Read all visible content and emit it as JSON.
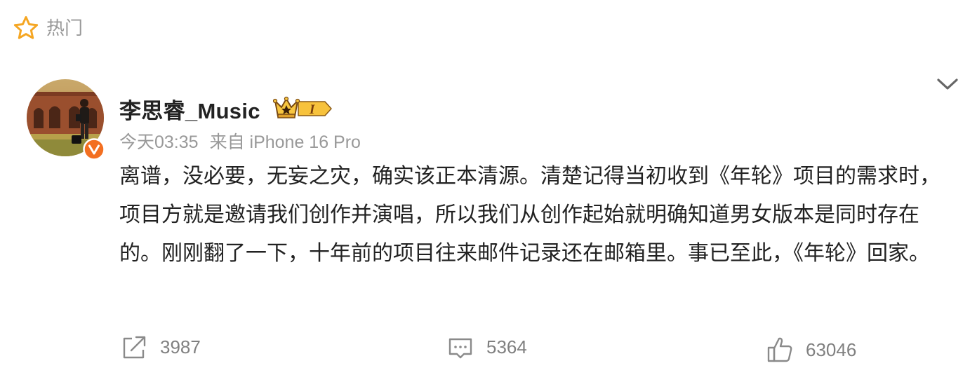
{
  "header": {
    "hot_label": "热门",
    "hot_icon": "star-outline-icon"
  },
  "post": {
    "author": {
      "name": "李思睿_Music",
      "avatar": "avatar-photo",
      "verified_badge": "verified-v-icon",
      "vip_badge_text": "I"
    },
    "meta": {
      "time": "今天03:35",
      "source": "来自 iPhone 16 Pro"
    },
    "text": "离谱，没必要，无妄之灾，确实该正本清源。清楚记得当初收到《年轮》项目的需求时，项目方就是邀请我们创作并演唱，所以我们从创作起始就明确知道男女版本是同时存在的。刚刚翻了一下，十年前的项目往来邮件记录还在邮箱里。事已至此，《年轮》回家。",
    "actions": {
      "repost_count": "3987",
      "comment_count": "5364",
      "like_count": "63046"
    }
  },
  "colors": {
    "accent_orange": "#f5a623",
    "badge_orange": "#f36f21",
    "muted_text": "#999999",
    "icon_gray": "#8a8a8a"
  }
}
